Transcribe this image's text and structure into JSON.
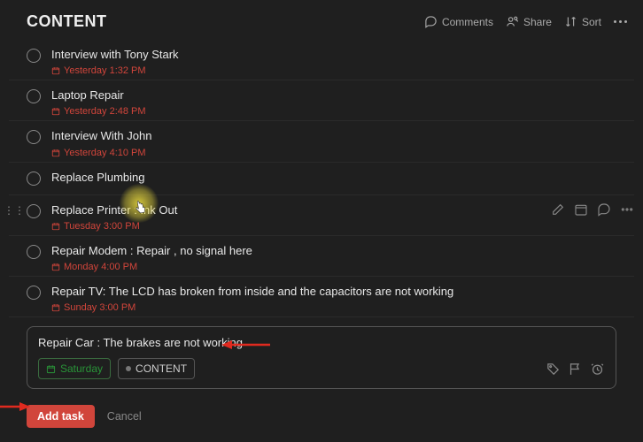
{
  "header": {
    "title": "CONTENT",
    "comments": "Comments",
    "share": "Share",
    "sort": "Sort"
  },
  "tasks": [
    {
      "title": "Interview with Tony Stark",
      "date": "Yesterday 1:32 PM",
      "has_date": true,
      "hovered": false
    },
    {
      "title": "Laptop Repair",
      "date": "Yesterday 2:48 PM",
      "has_date": true,
      "hovered": false
    },
    {
      "title": "Interview With John",
      "date": "Yesterday 4:10 PM",
      "has_date": true,
      "hovered": false
    },
    {
      "title": "Replace Plumbing",
      "date": "",
      "has_date": false,
      "hovered": false
    },
    {
      "title": "Replace Printer : Ink Out",
      "date": "Tuesday 3:00 PM",
      "has_date": true,
      "hovered": true
    },
    {
      "title": "Repair Modem : Repair , no signal here",
      "date": "Monday 4:00 PM",
      "has_date": true,
      "hovered": false
    },
    {
      "title": "Repair TV: The LCD has broken from inside and the capacitors are not working",
      "date": "Sunday 3:00 PM",
      "has_date": true,
      "hovered": false
    }
  ],
  "editor": {
    "input_value": "Repair Car : The brakes are not working",
    "placeholder": "Task name",
    "date_chip": "Saturday",
    "project_chip": "CONTENT"
  },
  "buttons": {
    "add": "Add task",
    "cancel": "Cancel"
  }
}
